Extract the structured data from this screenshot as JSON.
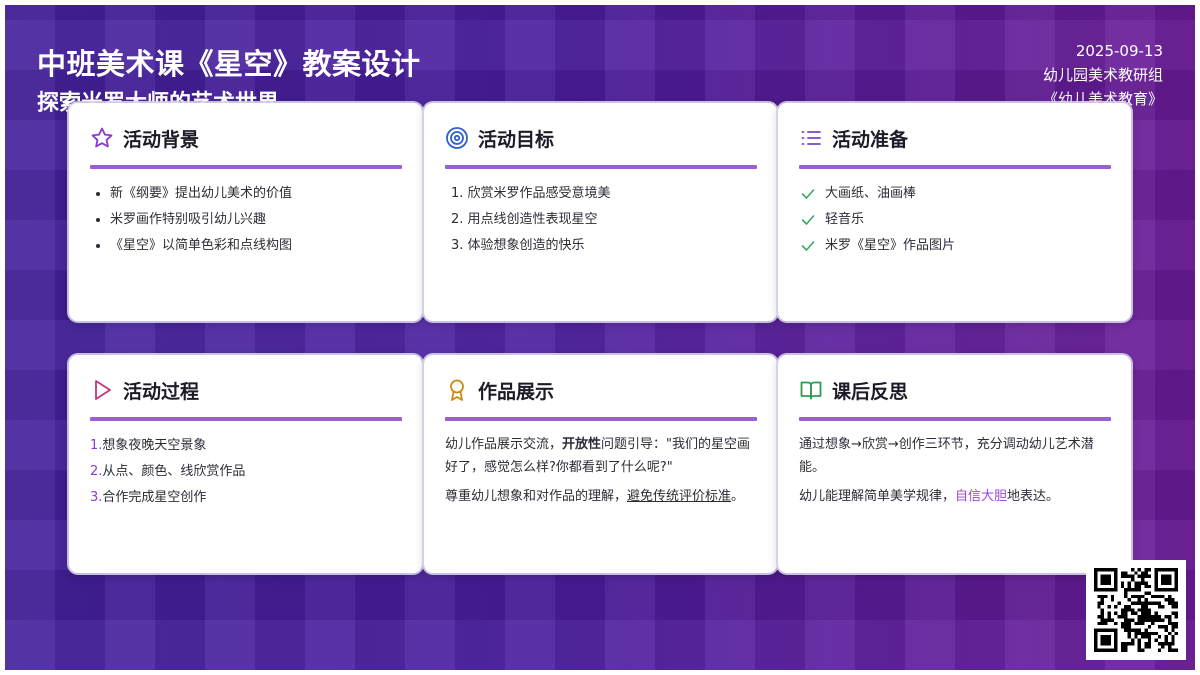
{
  "header": {
    "title": "中班美术课《星空》教案设计",
    "subtitle": "探索米罗大师的艺术世界",
    "date": "2025-09-13",
    "org": "幼儿园美术教研组",
    "publication": "《幼儿美术教育》"
  },
  "cards": {
    "background": {
      "title": "活动背景",
      "icon": "star-icon",
      "items": [
        "新《纲要》提出幼儿美术的价值",
        "米罗画作特别吸引幼儿兴趣",
        "《星空》以简单色彩和点线构图"
      ]
    },
    "goals": {
      "title": "活动目标",
      "icon": "target-icon",
      "items": [
        "1. 欣赏米罗作品感受意境美",
        "2. 用点线创造性表现星空",
        "3. 体验想象创造的快乐"
      ]
    },
    "prep": {
      "title": "活动准备",
      "icon": "list-icon",
      "items": [
        "大画纸、油画棒",
        "轻音乐",
        "米罗《星空》作品图片"
      ]
    },
    "process": {
      "title": "活动过程",
      "icon": "play-icon",
      "steps": [
        {
          "num": "1.",
          "text": "想象夜晚天空景象"
        },
        {
          "num": "2.",
          "text": "从点、颜色、线欣赏作品"
        },
        {
          "num": "3.",
          "text": "合作完成星空创作"
        }
      ]
    },
    "showcase": {
      "title": "作品展示",
      "icon": "award-icon",
      "p1_a": "幼儿作品展示交流，",
      "p1_b": "开放性",
      "p1_c": "问题引导：\"我们的星空画好了，感觉怎么样?你都看到了什么呢?\"",
      "p2_a": "尊重幼儿想象和对作品的理解，",
      "p2_b": "避免传统评价标准",
      "p2_c": "。"
    },
    "reflection": {
      "title": "课后反思",
      "icon": "book-icon",
      "p1": "通过想象→欣赏→创作三环节，充分调动幼儿艺术潜能。",
      "p2_a": "幼儿能理解简单美学规律，",
      "p2_b": "自信大胆",
      "p2_c": "地表达。"
    }
  },
  "colors": {
    "accent": "#9b5fd4",
    "star_icon": "#8a3ad0",
    "target_icon": "#2f5fc8",
    "list_icon": "#7a44cc",
    "check_icon": "#3aa864",
    "play_icon": "#c2357a",
    "award_icon": "#c98a12",
    "book_icon": "#2e9a55"
  },
  "qr_code": {
    "icon": "qr-code-icon"
  }
}
